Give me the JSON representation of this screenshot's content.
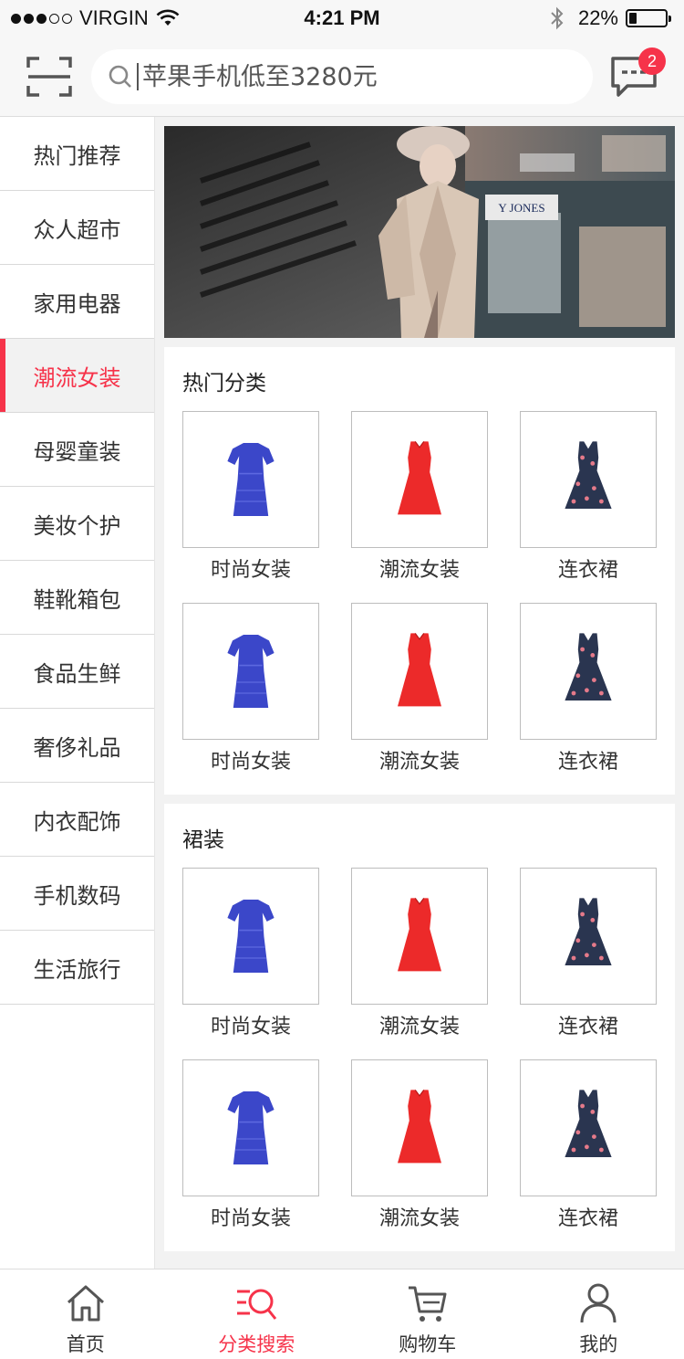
{
  "status_bar": {
    "carrier": "VIRGIN",
    "time": "4:21 PM",
    "battery": "22%",
    "battery_level": 0.22,
    "signal_bars_filled": 3,
    "signal_bars_total": 5
  },
  "header": {
    "search_placeholder": "苹果手机低至3280元",
    "message_badge": "2"
  },
  "sidebar": {
    "items": [
      {
        "label": "热门推荐"
      },
      {
        "label": "众人超市"
      },
      {
        "label": "家用电器"
      },
      {
        "label": "潮流女装"
      },
      {
        "label": "母婴童装"
      },
      {
        "label": "美妆个护"
      },
      {
        "label": "鞋靴箱包"
      },
      {
        "label": "食品生鲜"
      },
      {
        "label": "奢侈礼品"
      },
      {
        "label": "内衣配饰"
      },
      {
        "label": "手机数码"
      },
      {
        "label": "生活旅行"
      }
    ],
    "active_index": 3
  },
  "banner": {
    "sign_text": "Y JONES"
  },
  "sections": [
    {
      "title": "热门分类",
      "products": [
        {
          "name": "时尚女装",
          "image": "blue-lace-dress"
        },
        {
          "name": "潮流女装",
          "image": "red-dress"
        },
        {
          "name": "连衣裙",
          "image": "floral-navy-dress"
        },
        {
          "name": "时尚女装",
          "image": "blue-lace-dress"
        },
        {
          "name": "潮流女装",
          "image": "red-dress"
        },
        {
          "name": "连衣裙",
          "image": "floral-navy-dress"
        }
      ]
    },
    {
      "title": "裙装",
      "products": [
        {
          "name": "时尚女装",
          "image": "blue-lace-dress"
        },
        {
          "name": "潮流女装",
          "image": "red-dress"
        },
        {
          "name": "连衣裙",
          "image": "floral-navy-dress"
        },
        {
          "name": "时尚女装",
          "image": "blue-lace-dress"
        },
        {
          "name": "潮流女装",
          "image": "red-dress"
        },
        {
          "name": "连衣裙",
          "image": "floral-navy-dress"
        }
      ]
    }
  ],
  "tabbar": {
    "items": [
      {
        "label": "首页",
        "icon": "home-icon"
      },
      {
        "label": "分类搜索",
        "icon": "category-search-icon"
      },
      {
        "label": "购物车",
        "icon": "cart-icon"
      },
      {
        "label": "我的",
        "icon": "user-icon"
      }
    ],
    "active_index": 1
  },
  "colors": {
    "accent": "#f6334a",
    "text": "#333333",
    "background": "#f2f2f2"
  }
}
